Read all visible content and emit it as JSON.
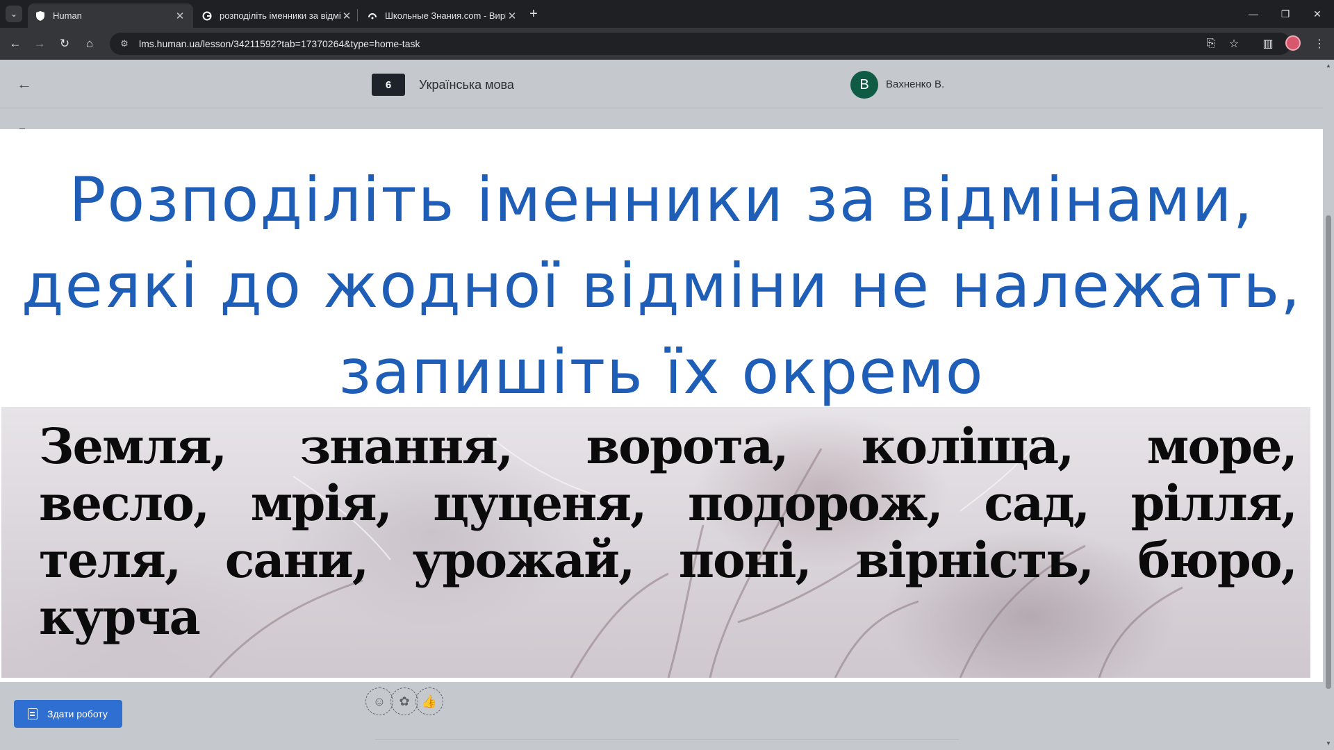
{
  "browser": {
    "tabs": [
      {
        "title": "Human",
        "favicon": "shield-icon",
        "active": true
      },
      {
        "title": "розподіліть іменники за відмі",
        "favicon": "google-icon",
        "active": false
      },
      {
        "title": "Школьные Знания.com - Вирі",
        "favicon": "znanija-icon",
        "active": false
      }
    ],
    "url": "lms.human.ua/lesson/34211592?tab=17370264&type=home-task"
  },
  "header": {
    "grade": "6",
    "subject": "Українська мова",
    "teacher_initial": "В",
    "teacher_name": "Вахненко В."
  },
  "task": {
    "heading_lines": [
      "Розподіліть іменники за відмінами,",
      "деякі до жодної відміни не належать,",
      "запишіть їх окремо"
    ],
    "word_lines": [
      [
        "Земля,",
        "знання,",
        "ворота,",
        "коліща,",
        "море,"
      ],
      [
        "весло,",
        "мрія,",
        "цуценя,",
        "подорож,",
        "сад,",
        "рілля,"
      ],
      [
        "теля,",
        "сани,",
        "урожай,",
        "поні,",
        "вірність,",
        "бюро,"
      ],
      [
        "курча"
      ]
    ]
  },
  "actions": {
    "submit_label": "Здати роботу",
    "reactions": [
      "emoji-smile-icon",
      "brain-icon",
      "thumbs-up-icon"
    ]
  },
  "colors": {
    "heading": "#1e5eb7",
    "submit": "#2f6fd1",
    "avatar": "#0f5b44"
  }
}
